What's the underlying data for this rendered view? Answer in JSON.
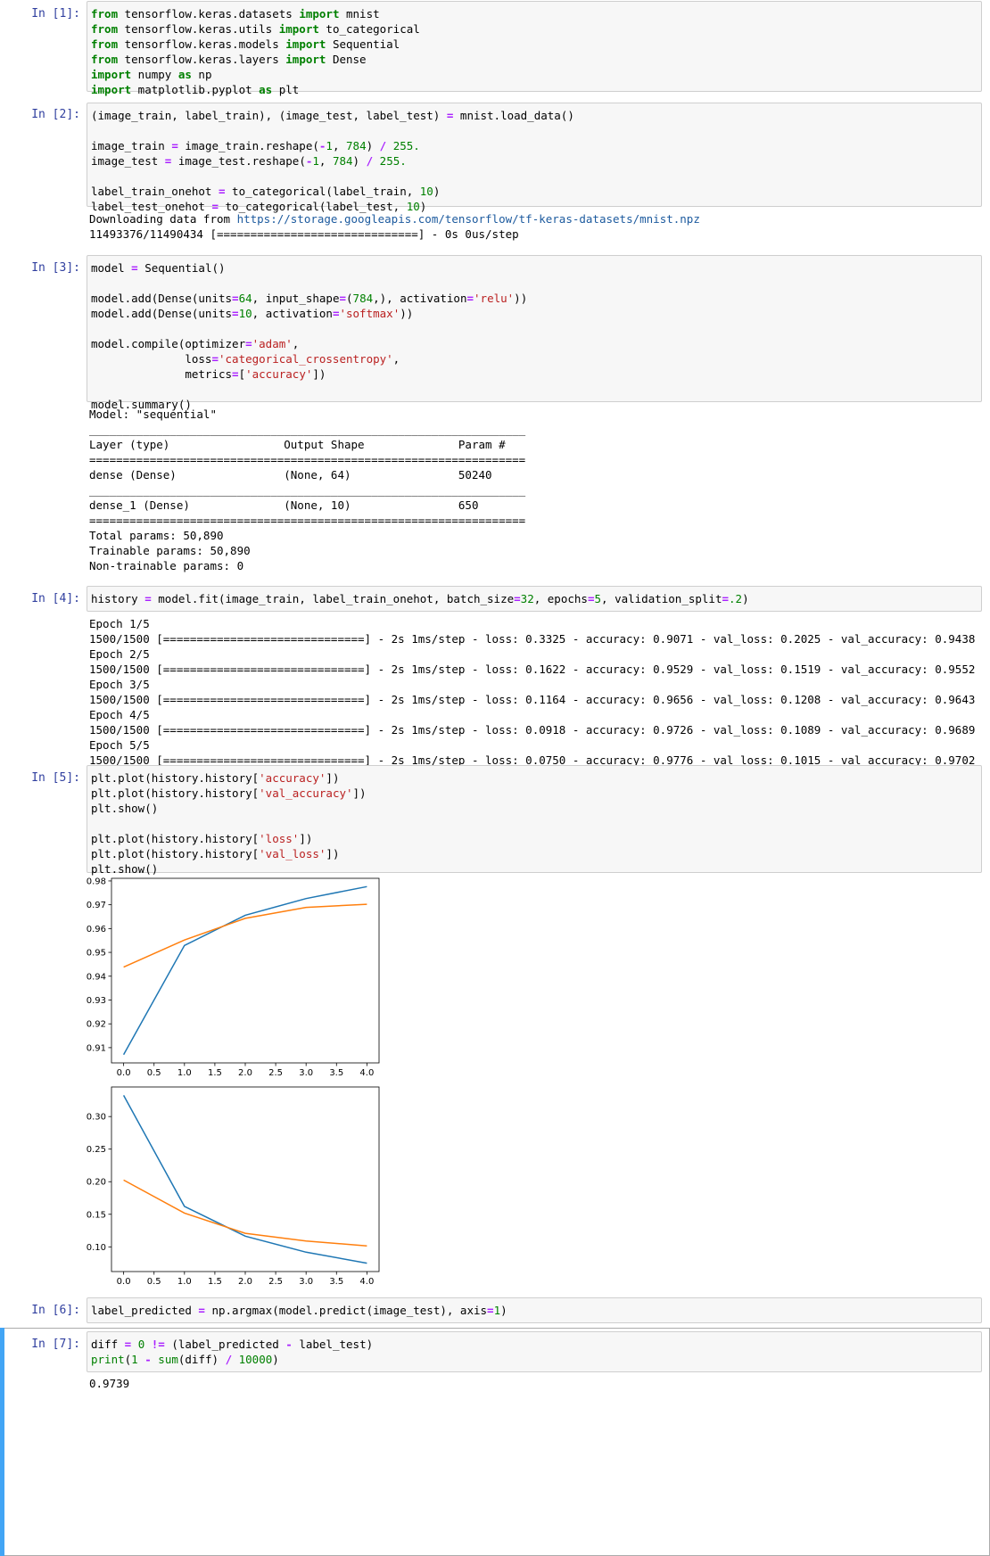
{
  "cells": {
    "c1": {
      "prompt": "In [1]:",
      "lines": [
        "from tensorflow.keras.datasets import mnist",
        "from tensorflow.keras.utils import to_categorical",
        "from tensorflow.keras.models import Sequential",
        "from tensorflow.keras.layers import Dense",
        "import numpy as np",
        "import matplotlib.pyplot as plt"
      ]
    },
    "c2": {
      "prompt": "In [2]:",
      "lines": [
        "(image_train, label_train), (image_test, label_test) = mnist.load_data()",
        "",
        "image_train = image_train.reshape(-1, 784) / 255.",
        "image_test = image_test.reshape(-1, 784) / 255.",
        "",
        "label_train_onehot = to_categorical(label_train, 10)",
        "label_test_onehot = to_categorical(label_test, 10)"
      ],
      "output": {
        "download_prefix": "Downloading data from ",
        "download_url": "https://storage.googleapis.com/tensorflow/tf-keras-datasets/mnist.npz",
        "progress": "11493376/11490434 [==============================] - 0s 0us/step"
      }
    },
    "c3": {
      "prompt": "In [3]:",
      "lines": [
        "model = Sequential()",
        "",
        "model.add(Dense(units=64, input_shape=(784,), activation='relu'))",
        "model.add(Dense(units=10, activation='softmax'))",
        "",
        "model.compile(optimizer='adam',",
        "              loss='categorical_crossentropy',",
        "              metrics=['accuracy'])",
        "",
        "model.summary()"
      ],
      "output": [
        "Model: \"sequential\"",
        "_________________________________________________________________",
        "Layer (type)                 Output Shape              Param #",
        "=================================================================",
        "dense (Dense)                (None, 64)                50240",
        "_________________________________________________________________",
        "dense_1 (Dense)              (None, 10)                650",
        "=================================================================",
        "Total params: 50,890",
        "Trainable params: 50,890",
        "Non-trainable params: 0",
        "_________________________________________________________________"
      ]
    },
    "c4": {
      "prompt": "In [4]:",
      "lines": [
        "history = model.fit(image_train, label_train_onehot, batch_size=32, epochs=5, validation_split=.2)"
      ],
      "output": [
        "Epoch 1/5",
        "1500/1500 [==============================] - 2s 1ms/step - loss: 0.3325 - accuracy: 0.9071 - val_loss: 0.2025 - val_accuracy: 0.9438",
        "Epoch 2/5",
        "1500/1500 [==============================] - 2s 1ms/step - loss: 0.1622 - accuracy: 0.9529 - val_loss: 0.1519 - val_accuracy: 0.9552",
        "Epoch 3/5",
        "1500/1500 [==============================] - 2s 1ms/step - loss: 0.1164 - accuracy: 0.9656 - val_loss: 0.1208 - val_accuracy: 0.9643",
        "Epoch 4/5",
        "1500/1500 [==============================] - 2s 1ms/step - loss: 0.0918 - accuracy: 0.9726 - val_loss: 0.1089 - val_accuracy: 0.9689",
        "Epoch 5/5",
        "1500/1500 [==============================] - 2s 1ms/step - loss: 0.0750 - accuracy: 0.9776 - val_loss: 0.1015 - val_accuracy: 0.9702"
      ]
    },
    "c5": {
      "prompt": "In [5]:",
      "lines": [
        "plt.plot(history.history['accuracy'])",
        "plt.plot(history.history['val_accuracy'])",
        "plt.show()",
        "",
        "plt.plot(history.history['loss'])",
        "plt.plot(history.history['val_loss'])",
        "plt.show()"
      ]
    },
    "c6": {
      "prompt": "In [6]:",
      "lines": [
        "label_predicted = np.argmax(model.predict(image_test), axis=1)"
      ]
    },
    "c7": {
      "prompt": "In [7]:",
      "lines": [
        "diff = 0 != (label_predicted - label_test)",
        "print(1 - sum(diff) / 10000)"
      ],
      "output": "0.9739"
    }
  },
  "colors": {
    "series1": "#1f77b4",
    "series2": "#ff7f0e",
    "prompt": "#303f9f",
    "selected": "#42a5f5"
  },
  "chart_data": [
    {
      "type": "line",
      "x": [
        0,
        1,
        2,
        3,
        4
      ],
      "series": [
        {
          "values": [
            0.9071,
            0.9529,
            0.9656,
            0.9726,
            0.9776
          ]
        },
        {
          "values": [
            0.9438,
            0.9552,
            0.9643,
            0.9689,
            0.9702
          ]
        }
      ],
      "xticks": [
        "0.0",
        "0.5",
        "1.0",
        "1.5",
        "2.0",
        "2.5",
        "3.0",
        "3.5",
        "4.0"
      ],
      "yticks": [
        "0.91",
        "0.92",
        "0.93",
        "0.94",
        "0.95",
        "0.96",
        "0.97",
        "0.98"
      ],
      "xlim": [
        -0.2,
        4.2
      ],
      "ylim": [
        0.9036,
        0.9811
      ],
      "grid": false
    },
    {
      "type": "line",
      "x": [
        0,
        1,
        2,
        3,
        4
      ],
      "series": [
        {
          "values": [
            0.3325,
            0.1622,
            0.1164,
            0.0918,
            0.075
          ]
        },
        {
          "values": [
            0.2025,
            0.1519,
            0.1208,
            0.1089,
            0.1015
          ]
        }
      ],
      "xticks": [
        "0.0",
        "0.5",
        "1.0",
        "1.5",
        "2.0",
        "2.5",
        "3.0",
        "3.5",
        "4.0"
      ],
      "yticks": [
        "0.10",
        "0.15",
        "0.20",
        "0.25",
        "0.30"
      ],
      "xlim": [
        -0.2,
        4.2
      ],
      "ylim": [
        0.0621,
        0.3454
      ],
      "grid": false
    }
  ]
}
